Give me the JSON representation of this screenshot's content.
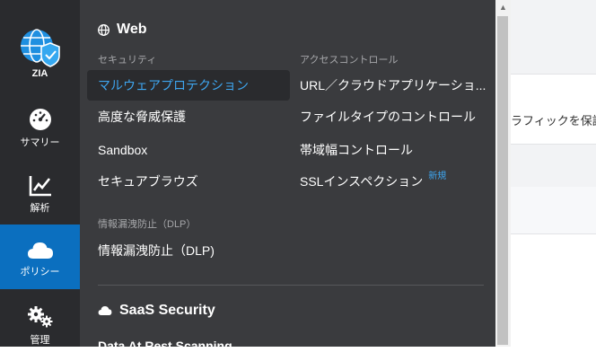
{
  "rail": {
    "zia_label": "ZIA",
    "items": [
      {
        "label": "サマリー",
        "icon": "dashboard-gauge-icon"
      },
      {
        "label": "解析",
        "icon": "line-chart-icon"
      },
      {
        "label": "ポリシー",
        "icon": "cloud-icon",
        "active": true
      },
      {
        "label": "管理",
        "icon": "gears-icon"
      }
    ]
  },
  "menu": {
    "web": {
      "title": "Web",
      "security_header": "セキュリティ",
      "security_items": [
        "マルウェアプロテクション",
        "高度な脅威保護",
        "Sandbox",
        "セキュアブラウズ"
      ],
      "access_header": "アクセスコントロール",
      "access_items": [
        "URL／クラウドアプリケーショ...",
        "ファイルタイプのコントロール",
        "帯域幅コントロール",
        "SSLインスペクション"
      ],
      "new_badge": "新規",
      "dlp_header": "情報漏洩防止（DLP）",
      "dlp_item": "情報漏洩防止（DLP)"
    },
    "saas": {
      "title": "SaaS Security",
      "cut_item": "Data At Rest Scanning"
    }
  },
  "background": {
    "partial_text": "ラフィックを保護"
  },
  "colors": {
    "rail_bg": "#2a2b2e",
    "menu_bg": "#3a3b3e",
    "active_blue": "#0b6fbf",
    "link_blue": "#3ea6f0"
  }
}
